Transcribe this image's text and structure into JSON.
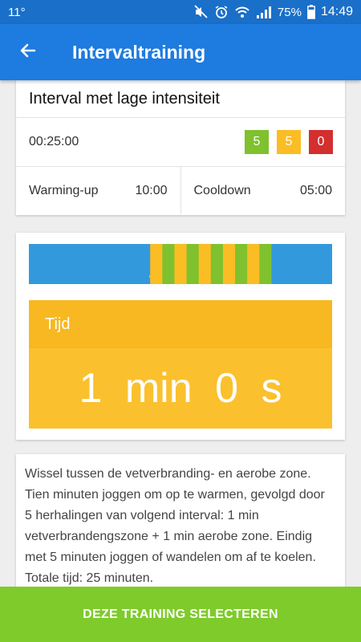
{
  "status_bar": {
    "temperature": "11°",
    "battery": "75%",
    "time": "14:49"
  },
  "app_bar": {
    "title": "Intervaltraining",
    "back_icon": "arrow-left-icon"
  },
  "training": {
    "name": "Interval met lage intensiteit",
    "duration": "00:25:00",
    "badges": [
      {
        "value": "5",
        "color": "#7fc12e"
      },
      {
        "value": "5",
        "color": "#fbbd24"
      },
      {
        "value": "0",
        "color": "#d32f2f"
      }
    ],
    "warmup_label": "Warming-up",
    "warmup_value": "10:00",
    "cooldown_label": "Cooldown",
    "cooldown_value": "05:00"
  },
  "timeline": {
    "colors": {
      "warmup": "#3399dd",
      "fatburn": "#fbbd24",
      "aerobic": "#7fc12e",
      "cooldown": "#3399dd"
    },
    "segments": [
      "warmup",
      "fatburn",
      "aerobic",
      "fatburn",
      "aerobic",
      "fatburn",
      "aerobic",
      "fatburn",
      "aerobic",
      "fatburn",
      "aerobic",
      "cooldown"
    ],
    "minutes": [
      10,
      1,
      1,
      1,
      1,
      1,
      1,
      1,
      1,
      1,
      1,
      5
    ]
  },
  "time_panel": {
    "label": "Tijd",
    "value": "1 min 0 s"
  },
  "description": "Wissel tussen de vetverbranding- en aerobe zone. Tien minuten joggen om op te warmen, gevolgd door 5 herhalingen van volgend interval: 1 min vetverbrandengszone + 1 min aerobe zone. Eindig met 5 minuten joggen of wandelen om af te koelen. Totale tijd: 25 minuten.",
  "select_button": "DEZE TRAINING SELECTEREN"
}
